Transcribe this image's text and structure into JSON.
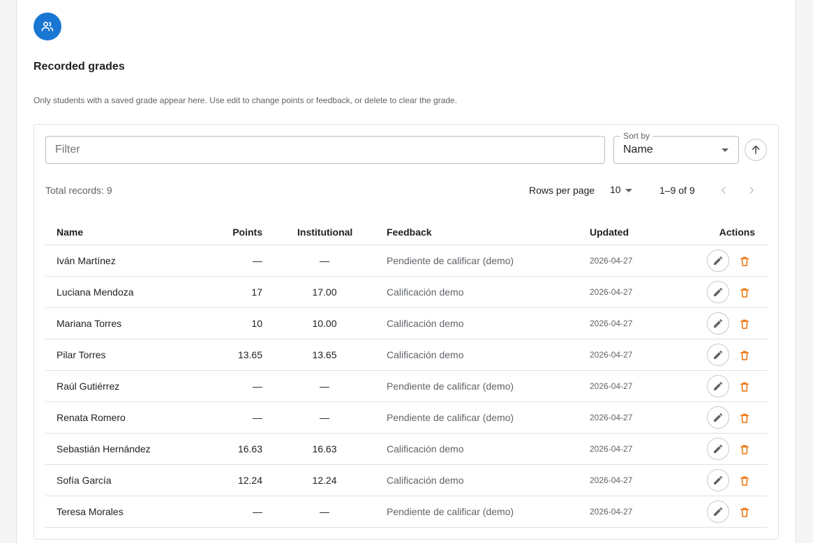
{
  "header": {
    "avatar_icon": "people-icon",
    "title": "Recorded grades",
    "subtitle": "Only students with a saved grade appear here. Use edit to change points or feedback, or delete to clear the grade."
  },
  "toolbar": {
    "filter_placeholder": "Filter",
    "sort_label": "Sort by",
    "sort_value": "Name",
    "sort_direction_icon": "arrow-up-icon"
  },
  "summary": {
    "total": "Total records: 9",
    "rows_per_page_label": "Rows per page",
    "rows_per_page_value": "10",
    "range": "1–9 of 9"
  },
  "table": {
    "columns": {
      "name": "Name",
      "points": "Points",
      "institutional": "Institutional",
      "feedback": "Feedback",
      "updated": "Updated",
      "actions": "Actions"
    },
    "rows": [
      {
        "name": "Iván Martínez",
        "points": "—",
        "institutional": "—",
        "feedback": "Pendiente de calificar (demo)",
        "updated": "2026-04-27"
      },
      {
        "name": "Luciana Mendoza",
        "points": "17",
        "institutional": "17.00",
        "feedback": "Calificación demo",
        "updated": "2026-04-27"
      },
      {
        "name": "Mariana Torres",
        "points": "10",
        "institutional": "10.00",
        "feedback": "Calificación demo",
        "updated": "2026-04-27"
      },
      {
        "name": "Pilar Torres",
        "points": "13.65",
        "institutional": "13.65",
        "feedback": "Calificación demo",
        "updated": "2026-04-27"
      },
      {
        "name": "Raúl Gutiérrez",
        "points": "—",
        "institutional": "—",
        "feedback": "Pendiente de calificar (demo)",
        "updated": "2026-04-27"
      },
      {
        "name": "Renata Romero",
        "points": "—",
        "institutional": "—",
        "feedback": "Pendiente de calificar (demo)",
        "updated": "2026-04-27"
      },
      {
        "name": "Sebastián Hernández",
        "points": "16.63",
        "institutional": "16.63",
        "feedback": "Calificación demo",
        "updated": "2026-04-27"
      },
      {
        "name": "Sofía García",
        "points": "12.24",
        "institutional": "12.24",
        "feedback": "Calificación demo",
        "updated": "2026-04-27"
      },
      {
        "name": "Teresa Morales",
        "points": "—",
        "institutional": "—",
        "feedback": "Pendiente de calificar (demo)",
        "updated": "2026-04-27"
      }
    ]
  },
  "colors": {
    "accent": "#1976d2",
    "delete": "#ef6c00",
    "border": "#e0e0e0"
  }
}
